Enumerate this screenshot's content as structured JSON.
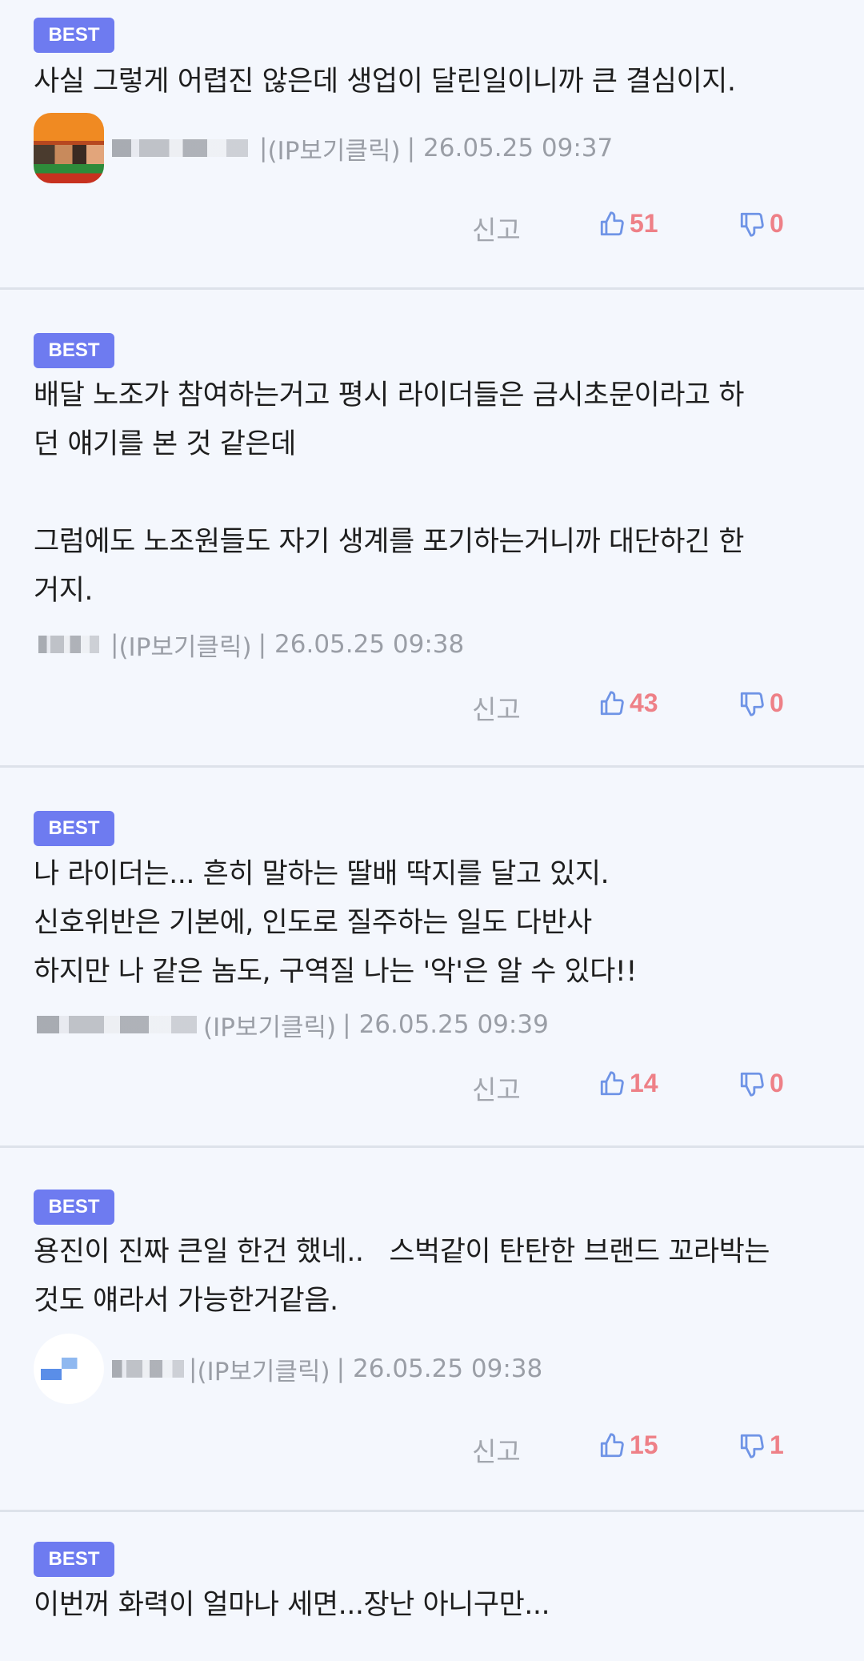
{
  "labels": {
    "best_badge": "BEST",
    "ip_click": "(IP보기클릭)",
    "separator": "|",
    "report": "신고"
  },
  "colors": {
    "badge_bg": "#6e7bf0",
    "vote_count": "#ee8087",
    "thumb_icon": "#6f94e6",
    "meta_text": "#9a9ea6",
    "background": "#f4f7fd"
  },
  "icons": {
    "upvote": "thumbs-up-outline-icon",
    "downvote": "thumbs-down-outline-icon"
  },
  "comments": [
    {
      "text": "사실 그렇게 어렵진 않은데 생업이 달린일이니까 큰 결심이지.",
      "timestamp": "26.05.25 09:37",
      "upvotes": "51",
      "downvotes": "0"
    },
    {
      "text": "배달 노조가 참여하는거고 평시 라이더들은 금시초문이라고 하\n던 얘기를 본 것 같은데\n\n그럼에도 노조원들도 자기 생계를 포기하는거니까 대단하긴 한\n거지.",
      "timestamp": "26.05.25 09:38",
      "upvotes": "43",
      "downvotes": "0"
    },
    {
      "text": "나 라이더는... 흔히 말하는 딸배 딱지를 달고 있지.\n신호위반은 기본에, 인도로 질주하는 일도 다반사\n하지만 나 같은 놈도, 구역질 나는 '악'은 알 수 있다!!",
      "timestamp": "26.05.25 09:39",
      "upvotes": "14",
      "downvotes": "0"
    },
    {
      "text": "용진이 진짜 큰일 한건 했네..   스벅같이 탄탄한 브랜드 꼬라박는\n것도 얘라서 가능한거같음.",
      "timestamp": "26.05.25 09:38",
      "upvotes": "15",
      "downvotes": "1"
    },
    {
      "text": "이번꺼 화력이 얼마나 세면...장난 아니구만..."
    }
  ]
}
